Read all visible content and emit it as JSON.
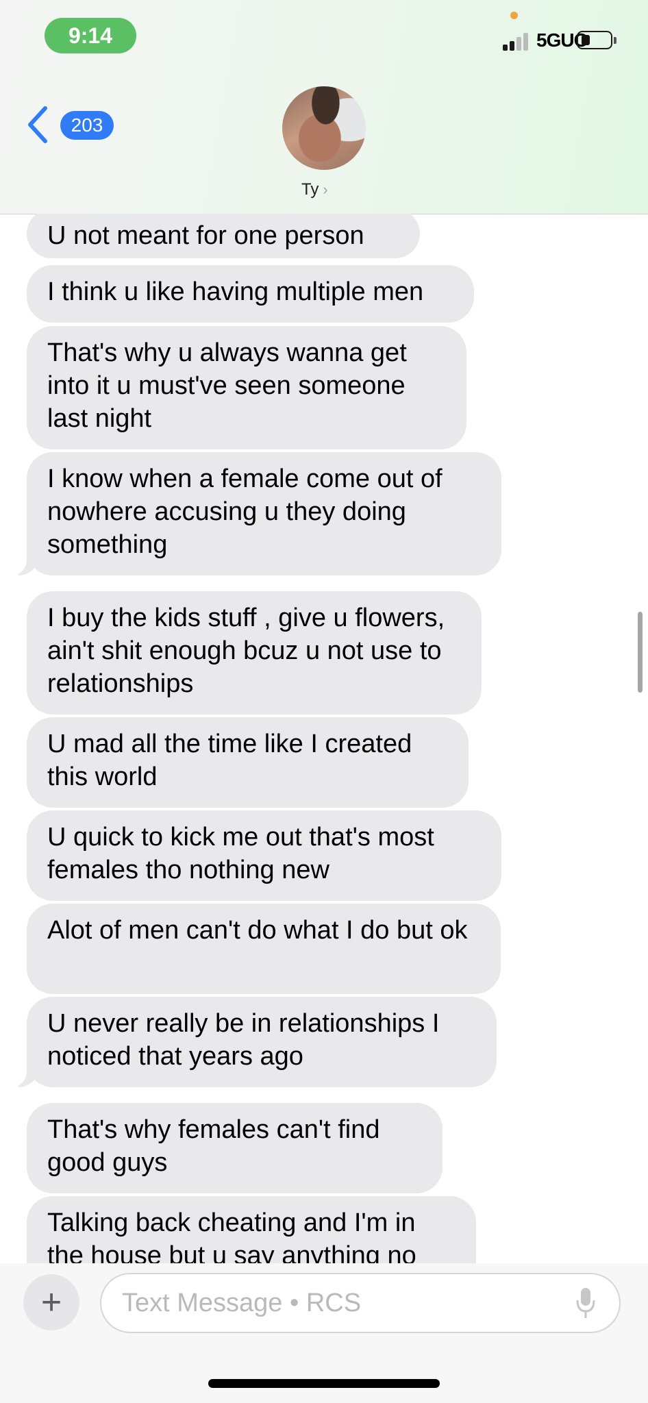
{
  "status_bar": {
    "time": "9:14",
    "network": "5GUC"
  },
  "nav": {
    "unread_count": "203",
    "contact_name": "Ty"
  },
  "messages": [
    "U not meant for one person",
    "I think u like having multiple men",
    "That's why u always wanna get into it u must've seen someone last night",
    "I know when a female come out of nowhere accusing u they doing something",
    "I buy the kids stuff , give u flowers, ain't shit enough bcuz u not use to relationships",
    "U mad all the time like I created this world",
    "U quick to kick me out that's most females tho nothing new",
    "Alot of men can't do what I do but ok",
    "U never really be in relationships I noticed that years ago",
    "That's why females can't find good guys",
    "Talking back cheating and I'm in the house but u say anything no"
  ],
  "composer": {
    "placeholder": "Text Message • RCS"
  },
  "colors": {
    "accent_blue": "#2f7cf6",
    "bubble_gray": "#e9e9eb",
    "time_pill_green": "#5bbf63"
  }
}
